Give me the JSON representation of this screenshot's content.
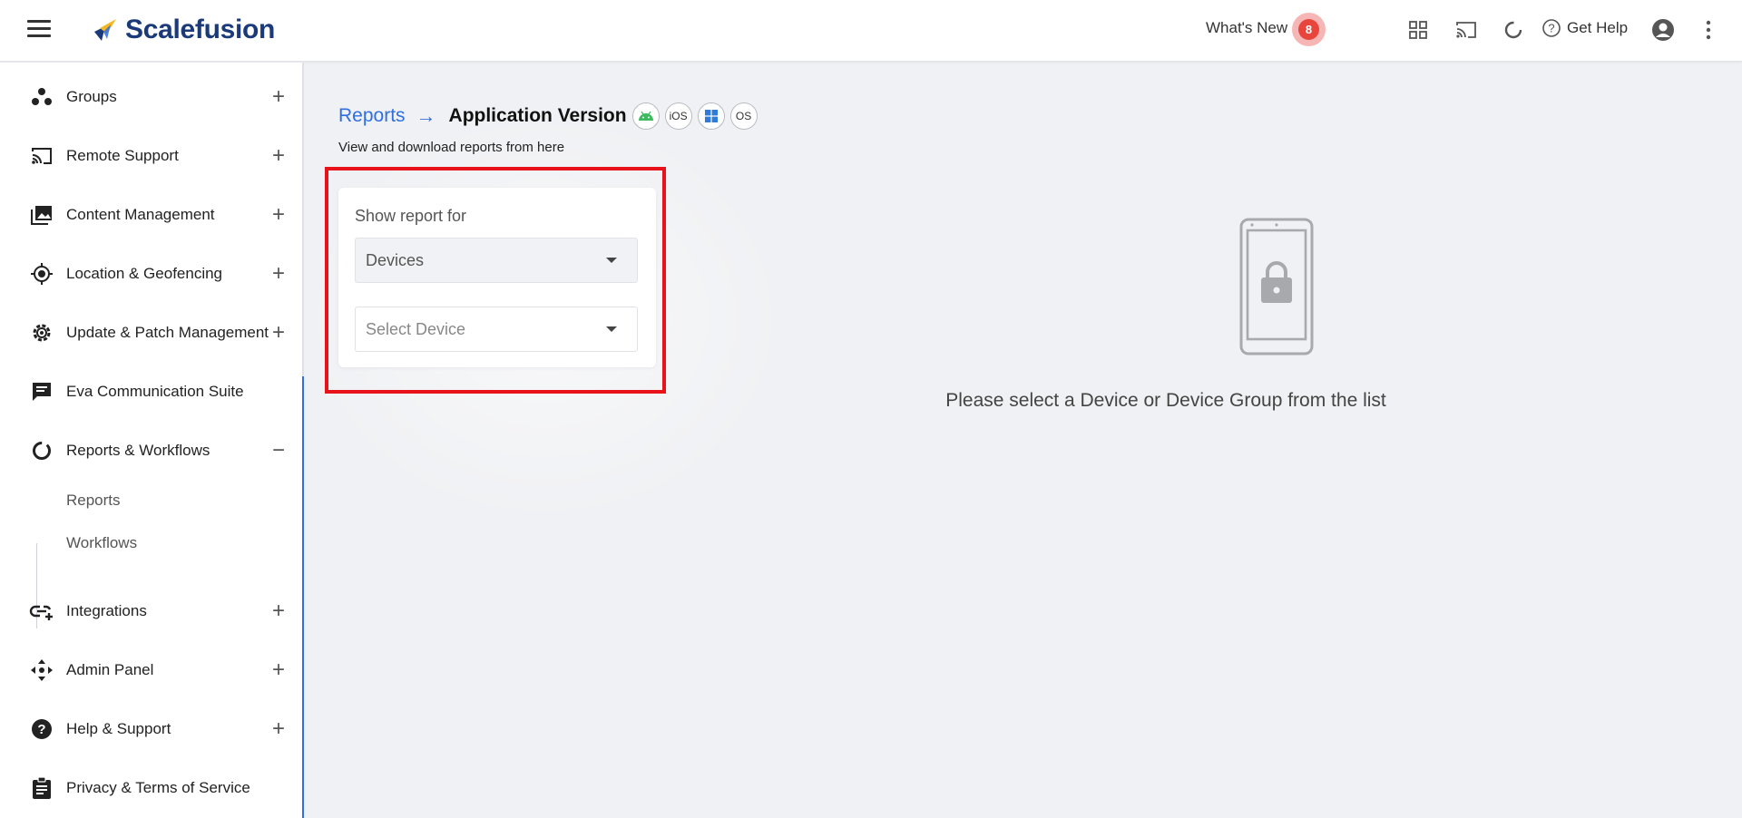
{
  "app": {
    "brand": "Scalefusion"
  },
  "topbar": {
    "whats_new_label": "What's New",
    "whats_new_count": "8",
    "get_help_label": "Get Help"
  },
  "sidebar": {
    "items": [
      {
        "label": "Groups",
        "icon": "groups-icon",
        "toggle": "+"
      },
      {
        "label": "Remote Support",
        "icon": "cast-icon",
        "toggle": "+"
      },
      {
        "label": "Content Management",
        "icon": "photo-library-icon",
        "toggle": "+"
      },
      {
        "label": "Location & Geofencing",
        "icon": "location-target-icon",
        "toggle": "+"
      },
      {
        "label": "Update & Patch Management",
        "icon": "gear-icon",
        "toggle": "+"
      },
      {
        "label": "Eva Communication Suite",
        "icon": "chat-icon",
        "toggle": ""
      },
      {
        "label": "Reports & Workflows",
        "icon": "donut-chart-icon",
        "toggle": "−"
      },
      {
        "label": "Integrations",
        "icon": "link-add-icon",
        "toggle": "+"
      },
      {
        "label": "Admin Panel",
        "icon": "move-arrows-icon",
        "toggle": "+"
      },
      {
        "label": "Help & Support",
        "icon": "help-circle-icon",
        "toggle": "+"
      },
      {
        "label": "Privacy & Terms of Service",
        "icon": "clipboard-icon",
        "toggle": ""
      }
    ],
    "sub_items": [
      {
        "label": "Reports"
      },
      {
        "label": "Workflows"
      }
    ]
  },
  "main": {
    "breadcrumb": {
      "parent": "Reports",
      "current": "Application Version"
    },
    "os_badges": [
      {
        "icon": "android-icon",
        "label": ""
      },
      {
        "icon": "ios-icon",
        "label": "iOS"
      },
      {
        "icon": "windows-icon",
        "label": ""
      },
      {
        "icon": "macos-icon",
        "label": "OS"
      }
    ],
    "subtitle": "View and download reports from here",
    "filter": {
      "label": "Show report for",
      "type_value": "Devices",
      "device_placeholder": "Select Device"
    },
    "empty_message": "Please select a Device or Device Group from the list"
  },
  "colors": {
    "accent": "#2f6fe0",
    "brand": "#1b3a7a",
    "highlight": "#e8121b",
    "badge": "#e8453c"
  }
}
